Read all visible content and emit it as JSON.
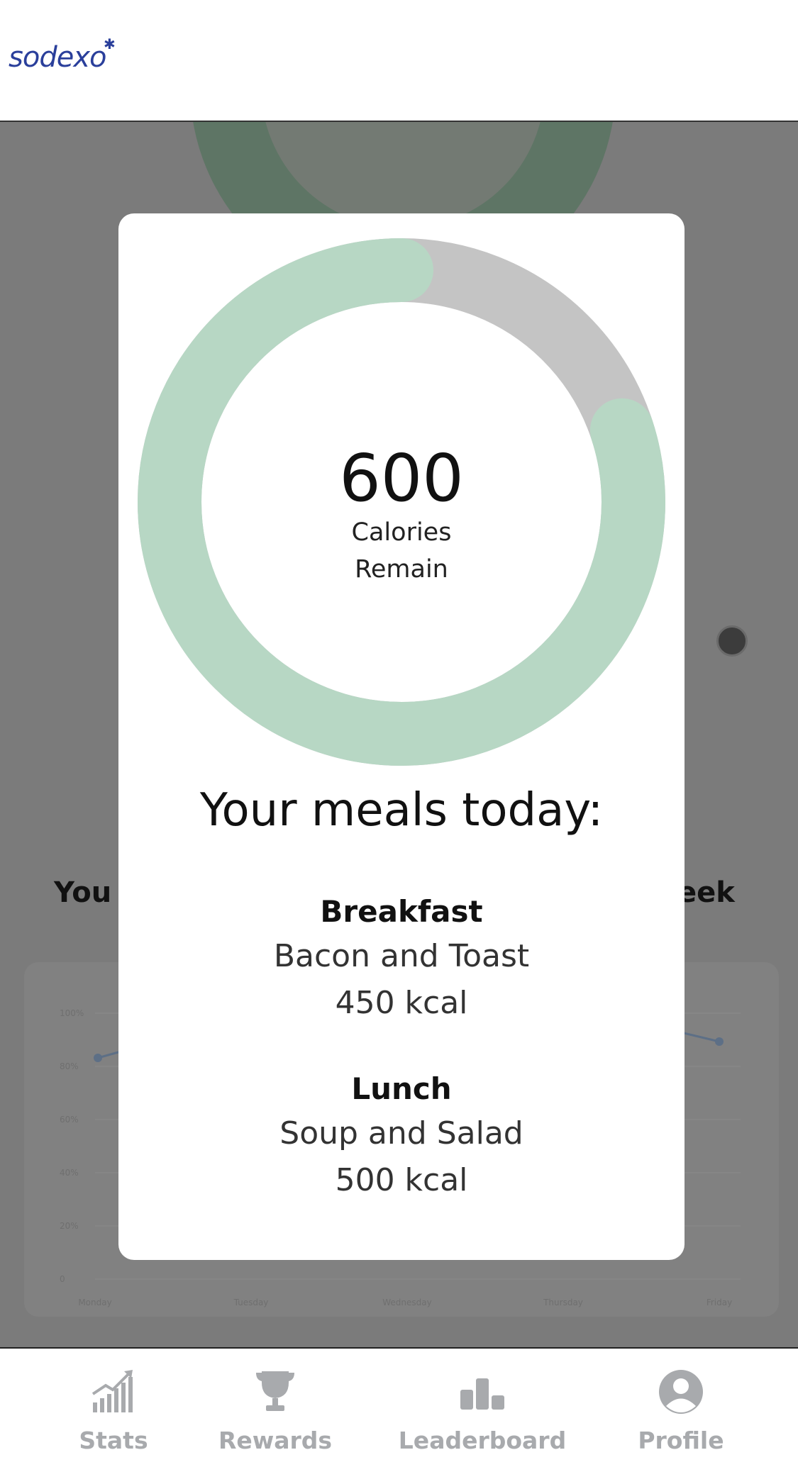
{
  "header": {
    "logo_text": "sodexo"
  },
  "background": {
    "heading_left": "You",
    "heading_right": "eek",
    "chart_y_ticks": [
      "100%",
      "80%",
      "60%",
      "40%",
      "20%",
      "0"
    ],
    "chart_x_ticks": [
      "Monday",
      "Tuesday",
      "Wednesday",
      "Thursday",
      "Friday"
    ]
  },
  "modal": {
    "calories_remaining": "600",
    "calories_label_line1": "Calories",
    "calories_label_line2": "Remain",
    "ring_consumed_fraction": 0.8,
    "colors": {
      "ring_fill": "#b7d7c4",
      "ring_track": "#c4c4c4"
    },
    "meals_title": "Your meals today:",
    "meals": [
      {
        "name": "Breakfast",
        "food": "Bacon and Toast",
        "kcal": "450 kcal"
      },
      {
        "name": "Lunch",
        "food": "Soup and Salad",
        "kcal": "500 kcal"
      }
    ]
  },
  "nav": {
    "items": [
      {
        "label": "Stats",
        "icon": "chart-growth-icon"
      },
      {
        "label": "Rewards",
        "icon": "trophy-icon"
      },
      {
        "label": "Leaderboard",
        "icon": "podium-icon"
      },
      {
        "label": "Profile",
        "icon": "user-avatar-icon"
      }
    ],
    "colors": {
      "inactive": "#a8aaad"
    }
  }
}
